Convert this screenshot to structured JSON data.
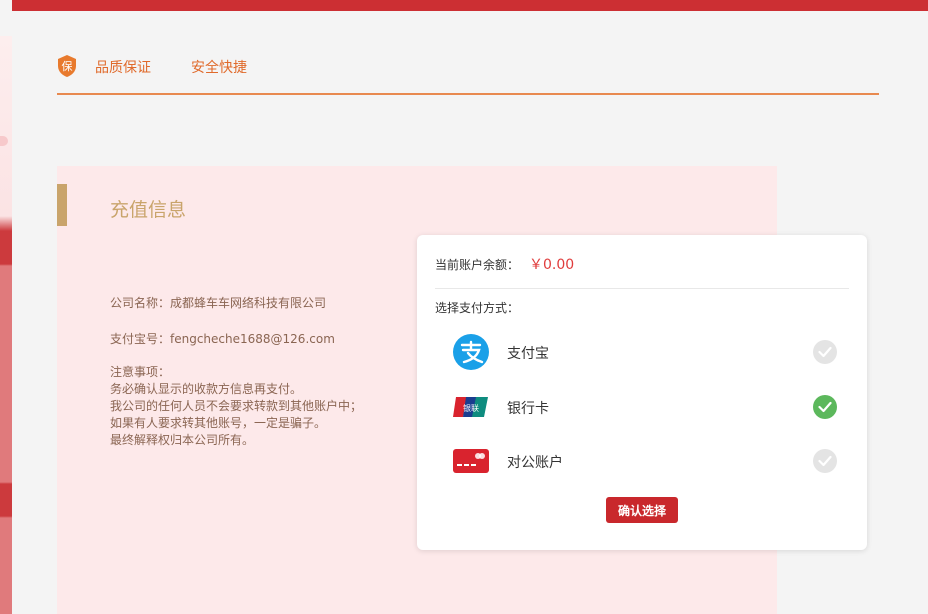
{
  "header": {
    "badge_char": "保",
    "quality_label": "品质保证",
    "safe_label": "安全快捷"
  },
  "panel": {
    "title": "充值信息",
    "company_line": "公司名称：成都蜂车车网络科技有限公司",
    "alipay_line": "支付宝号：fengcheche1688@126.com",
    "notice_title": "注意事项：",
    "notice_lines": [
      "务必确认显示的收款方信息再支付。",
      "我公司的任何人员不会要求转款到其他账户中；",
      "如果有人要求转其他账号，一定是骗子。",
      "最终解释权归本公司所有。"
    ]
  },
  "card": {
    "balance_label": "当前账户余额：",
    "balance_value": "￥0.00",
    "method_label": "选择支付方式：",
    "methods": [
      {
        "name": "支付宝",
        "icon": "alipay-icon",
        "selected": false
      },
      {
        "name": "银行卡",
        "icon": "unionpay-icon",
        "selected": true,
        "icon_text": "银联"
      },
      {
        "name": "对公账户",
        "icon": "corporate-card-icon",
        "selected": false
      }
    ],
    "confirm_label": "确认选择"
  },
  "colors": {
    "brand_red": "#cc2f33",
    "accent_orange": "#e06a2b",
    "panel_bg": "#fde9ea",
    "gold": "#c9a46b",
    "check_green": "#5cb85c",
    "alipay_blue": "#1aa0e8"
  }
}
